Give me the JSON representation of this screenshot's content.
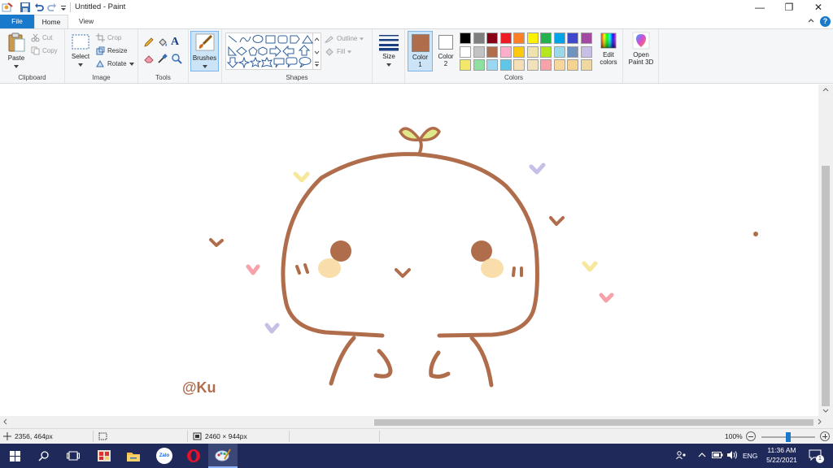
{
  "window": {
    "title": "Untitled - Paint",
    "minimize_glyph": "—",
    "maximize_glyph": "❐",
    "close_glyph": "✕",
    "help_glyph": "?"
  },
  "tabs": [
    {
      "label": "File"
    },
    {
      "label": "Home"
    },
    {
      "label": "View"
    }
  ],
  "ribbon": {
    "clipboard": {
      "label": "Clipboard",
      "paste": "Paste",
      "cut": "Cut",
      "copy": "Copy"
    },
    "image": {
      "label": "Image",
      "select": "Select",
      "crop": "Crop",
      "resize": "Resize",
      "rotate": "Rotate"
    },
    "tools": {
      "label": "Tools"
    },
    "brushes": {
      "label": "Brushes"
    },
    "shapes": {
      "label": "Shapes",
      "outline": "Outline",
      "fill": "Fill"
    },
    "size": {
      "label": "Size"
    },
    "colors": {
      "label": "Colors",
      "color1_label": "Color",
      "color1_num": "1",
      "color2_label": "Color",
      "color2_num": "2",
      "color1": "#b06d4c",
      "color2": "#ffffff",
      "edit_colors_line1": "Edit",
      "edit_colors_line2": "colors",
      "palette_row1": [
        "#000000",
        "#7f7f7f",
        "#880015",
        "#ed1c24",
        "#ff7f27",
        "#fff200",
        "#22b14c",
        "#00a2e8",
        "#3f48cc",
        "#a349a4"
      ],
      "palette_row2": [
        "#ffffff",
        "#c3c3c3",
        "#b06d4c",
        "#ffaec9",
        "#ffc90e",
        "#efe4b0",
        "#b5e61d",
        "#99d9ea",
        "#7092be",
        "#c8bfe7"
      ],
      "palette_row3": [
        "#f3e76a",
        "#8ee0a0",
        "#9ad7f0",
        "#5ec7e8",
        "#f5dfb4",
        "#f0e3bb",
        "#f7a2aa",
        "#f8d79c",
        "#f3d38e",
        "#f0d9a0"
      ]
    },
    "paint3d": {
      "line1": "Open",
      "line2": "Paint 3D"
    }
  },
  "canvas": {
    "signature": "@Ku",
    "stroke_color": "#b06d4c"
  },
  "status": {
    "cursor_pos": "2356, 464px",
    "selection_size": "",
    "image_size": "2460 × 944px",
    "zoom": "100%",
    "zoom_fraction": 0.5
  },
  "taskbar": {
    "lang": "ENG",
    "time": "11:36 AM",
    "date": "5/22/2021",
    "notification_count": "1",
    "zalo_label": "Zalo"
  }
}
